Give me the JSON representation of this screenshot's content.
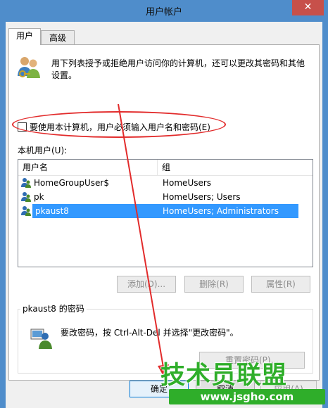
{
  "window": {
    "title": "用户帐户",
    "close_glyph": "✕"
  },
  "tabs": [
    {
      "label": "用户",
      "active": true
    },
    {
      "label": "高级",
      "active": false
    }
  ],
  "description": "用下列表授予或拒绝用户访问你的计算机，还可以更改其密码和其他设置。",
  "require_login_checkbox": {
    "label": "要使用本计算机，用户必须输入用户名和密码(E)",
    "checked": false
  },
  "local_users": {
    "label": "本机用户(U):",
    "columns": [
      "用户名",
      "组"
    ],
    "rows": [
      {
        "name": "HomeGroupUser$",
        "group": "HomeUsers",
        "selected": false
      },
      {
        "name": "pk",
        "group": "HomeUsers; Users",
        "selected": false
      },
      {
        "name": "pkaust8",
        "group": "HomeUsers; Administrators",
        "selected": true
      }
    ]
  },
  "user_buttons": {
    "add": "添加(D)...",
    "remove": "删除(R)",
    "properties": "属性(R)"
  },
  "password_group": {
    "title": "pkaust8 的密码",
    "text": "要改密码，按 Ctrl-Alt-Del 并选择\"更改密码\"。",
    "reset_button": "重置密码(P)..."
  },
  "dialog_buttons": {
    "ok": "确定",
    "cancel": "取消",
    "apply": "应用(A)"
  },
  "watermark": {
    "brand": "技术员联盟",
    "url": "www.jsgho.com"
  },
  "colors": {
    "annotation_red": "#e22b2b",
    "selection_blue": "#3399ff",
    "watermark_green": "#2fae2a"
  },
  "icons": {
    "users": "users-icon",
    "user_row": "user-icon",
    "password": "password-icon"
  }
}
